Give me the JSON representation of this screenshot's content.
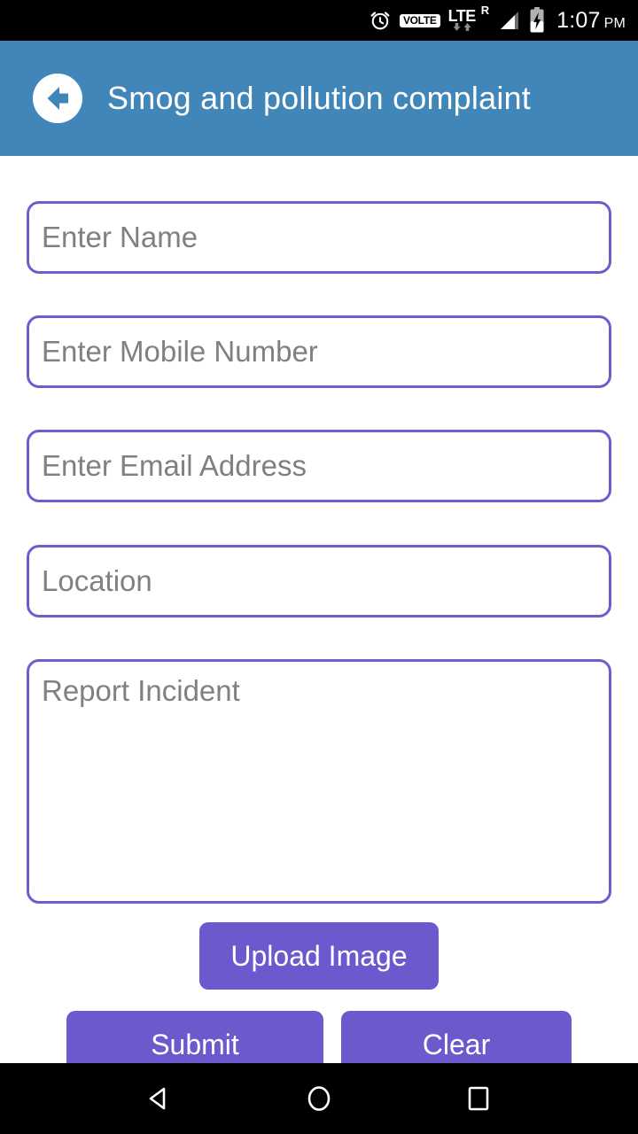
{
  "status_bar": {
    "alarm_icon": "alarm-clock-icon",
    "volte_label": "VOLTE",
    "network_label": "LTE",
    "roaming_label": "R",
    "signal_icon": "signal-bars-icon",
    "battery_icon": "battery-charging-icon",
    "time": "1:07",
    "meridiem": "PM"
  },
  "app_bar": {
    "back_icon": "back-arrow-circle-icon",
    "title": "Smog and pollution complaint",
    "background_color": "#4186b8"
  },
  "form": {
    "accent_color": "#6c5ecf",
    "button_color": "#6a5acd",
    "placeholder_color": "#808080",
    "fields": [
      {
        "name": "name",
        "placeholder": "Enter Name",
        "value": ""
      },
      {
        "name": "mobile",
        "placeholder": "Enter Mobile Number",
        "value": ""
      },
      {
        "name": "email",
        "placeholder": "Enter Email Address",
        "value": ""
      },
      {
        "name": "location",
        "placeholder": "Location",
        "value": ""
      },
      {
        "name": "report",
        "placeholder": "Report Incident",
        "value": ""
      }
    ],
    "buttons": {
      "upload": "Upload Image",
      "submit": "Submit",
      "clear": "Clear"
    }
  },
  "nav_bar": {
    "back_icon": "nav-back-triangle-icon",
    "home_icon": "nav-home-circle-icon",
    "recents_icon": "nav-recents-square-icon"
  }
}
